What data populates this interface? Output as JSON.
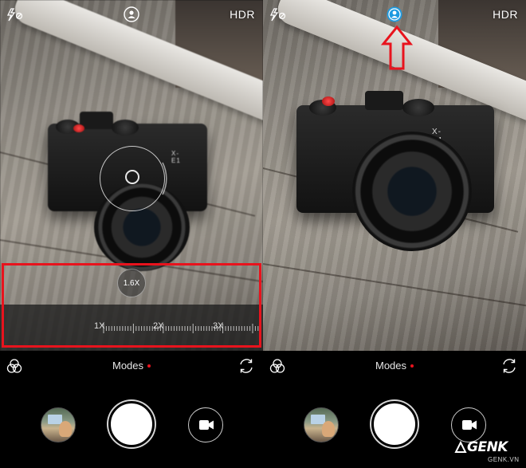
{
  "left": {
    "hdr_label": "HDR",
    "zoom_value": "1.6X",
    "zoom_marks": [
      "1X",
      "2X",
      "3X"
    ],
    "modes_label": "Modes",
    "camera_label": "X-E1"
  },
  "right": {
    "hdr_label": "HDR",
    "modes_label": "Modes",
    "camera_label": "X-E1",
    "beauty_active": true
  },
  "icons": [
    "flash-auto-icon",
    "beauty-icon",
    "filter-icon",
    "switch-camera-icon",
    "video-icon"
  ],
  "colors": {
    "accent": "#1e9ae0",
    "highlight": "#e8131d",
    "mode_dot": "#e8131d"
  },
  "watermark": {
    "brand": "GENK",
    "site": "GENK.VN"
  }
}
